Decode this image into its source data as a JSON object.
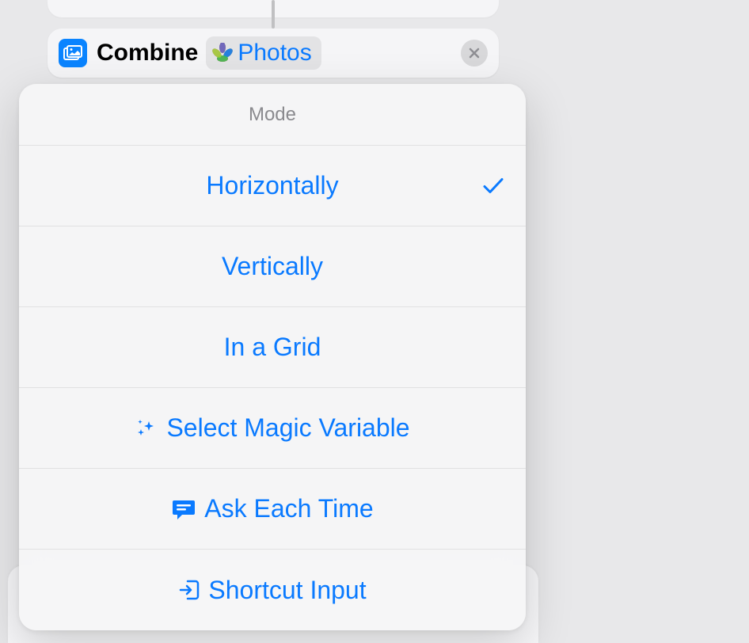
{
  "action_card": {
    "title": "Combine",
    "param_label": "Photos"
  },
  "menu": {
    "header": "Mode",
    "items": [
      {
        "label": "Horizontally",
        "selected": true,
        "icon": null
      },
      {
        "label": "Vertically",
        "selected": false,
        "icon": null
      },
      {
        "label": "In a Grid",
        "selected": false,
        "icon": null
      },
      {
        "label": "Select Magic Variable",
        "selected": false,
        "icon": "sparkles"
      },
      {
        "label": "Ask Each Time",
        "selected": false,
        "icon": "message"
      },
      {
        "label": "Shortcut Input",
        "selected": false,
        "icon": "input"
      }
    ]
  },
  "colors": {
    "accent": "#0a7aff",
    "icon_bg": "#0a84ff",
    "muted": "#8a8a8e"
  }
}
